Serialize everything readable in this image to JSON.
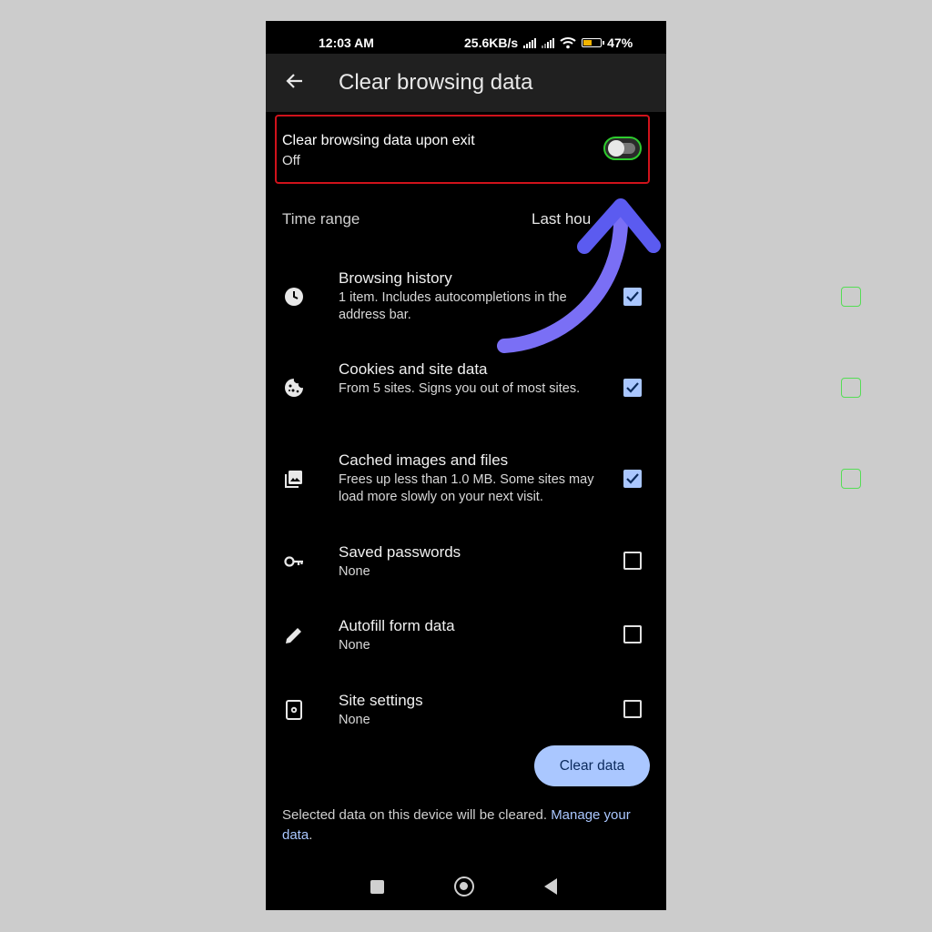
{
  "status_bar": {
    "time": "12:03 AM",
    "network_speed": "25.6KB/s",
    "battery": "47%"
  },
  "app_bar": {
    "title": "Clear browsing data",
    "back_icon": "arrow-back-icon"
  },
  "exit_setting": {
    "label": "Clear browsing data upon exit",
    "state": "Off",
    "toggle_on": false
  },
  "time_range": {
    "label": "Time range",
    "value": "Last hou"
  },
  "items": [
    {
      "title": "Browsing history",
      "desc": "1 item. Includes autocompletions in the address bar.",
      "icon": "clock-icon",
      "checked": true
    },
    {
      "title": "Cookies and site data",
      "desc": "From 5 sites. Signs you out of most sites.",
      "icon": "cookie-icon",
      "checked": true
    },
    {
      "title": "Cached images and files",
      "desc": "Frees up less than 1.0 MB. Some sites may load more slowly on your next visit.",
      "icon": "image-icon",
      "checked": true
    },
    {
      "title": "Saved passwords",
      "desc": "None",
      "icon": "key-icon",
      "checked": false
    },
    {
      "title": "Autofill form data",
      "desc": "None",
      "icon": "pencil-icon",
      "checked": false
    },
    {
      "title": "Site settings",
      "desc": "None",
      "icon": "site-settings-icon",
      "checked": false
    }
  ],
  "clear_button": "Clear data",
  "footer": {
    "text": "Selected data on this device will be cleared. ",
    "link": "Manage your data",
    "period": "."
  },
  "colors": {
    "accent": "#aac7ff",
    "highlight_box": "#d0121b",
    "toggle_outline": "#2ecc2e",
    "annotation_arrow": "#6a6af0"
  }
}
